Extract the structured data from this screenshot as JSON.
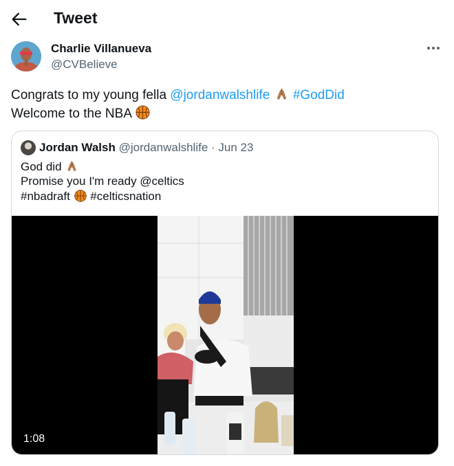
{
  "header": {
    "title": "Tweet",
    "back_icon": "arrow-left-icon"
  },
  "author": {
    "display_name": "Charlie Villanueva",
    "handle": "@CVBelieve"
  },
  "more_icon": "ellipsis-icon",
  "tweet": {
    "line1": {
      "text": "Congrats to my young fella ",
      "mention": "@jordanwalshlife",
      "emoji": "folded-hands-icon",
      "hashtag": "#GodDid"
    },
    "line2": {
      "text": "Welcome to the NBA ",
      "emoji": "basketball-icon"
    }
  },
  "quoted": {
    "display_name": "Jordan Walsh",
    "handle": "@jordanwalshlife",
    "separator": " · ",
    "date": "Jun 23",
    "line1": "God did ",
    "line2": "Promise you I'm ready @celtics",
    "line3_a": "#nbadraft ",
    "line3_b": " #celticsnation",
    "video_duration": "1:08"
  },
  "colors": {
    "link": "#1d9bf0",
    "secondary_text": "#536471",
    "border": "#cfd9de"
  }
}
